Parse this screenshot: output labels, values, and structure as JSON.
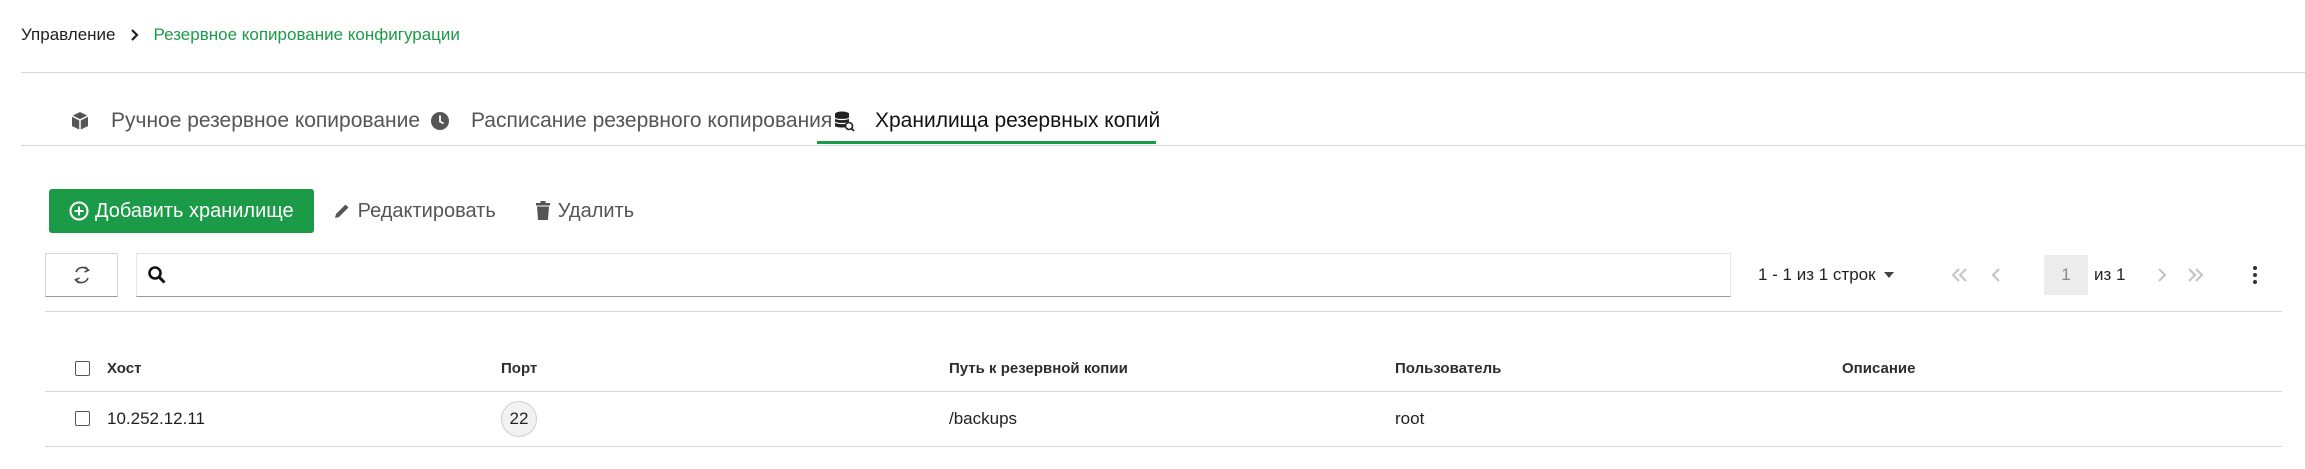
{
  "breadcrumb": {
    "root": "Управление",
    "current": "Резервное копирование конфигурации"
  },
  "tabs": [
    {
      "label": "Ручное резервное копирование",
      "icon": "box-icon",
      "active": false
    },
    {
      "label": "Расписание резервного копирования",
      "icon": "clock-icon",
      "active": false
    },
    {
      "label": "Хранилища резервных копий",
      "icon": "database-icon",
      "active": true
    }
  ],
  "toolbar": {
    "add_label": "Добавить хранилище",
    "edit_label": "Редактировать",
    "delete_label": "Удалить"
  },
  "search": {
    "placeholder": "",
    "value": ""
  },
  "pager": {
    "count_text": "1 - 1 из 1 строк",
    "current_page": "1",
    "of_text": "из 1"
  },
  "table": {
    "columns": [
      "Хост",
      "Порт",
      "Путь к резервной копии",
      "Пользователь",
      "Описание"
    ],
    "rows": [
      {
        "host": "10.252.12.11",
        "port": "22",
        "path": "/backups",
        "user": "root",
        "description": ""
      }
    ]
  },
  "colors": {
    "accent": "#1b9a47",
    "divider": "#d6d6d6"
  }
}
